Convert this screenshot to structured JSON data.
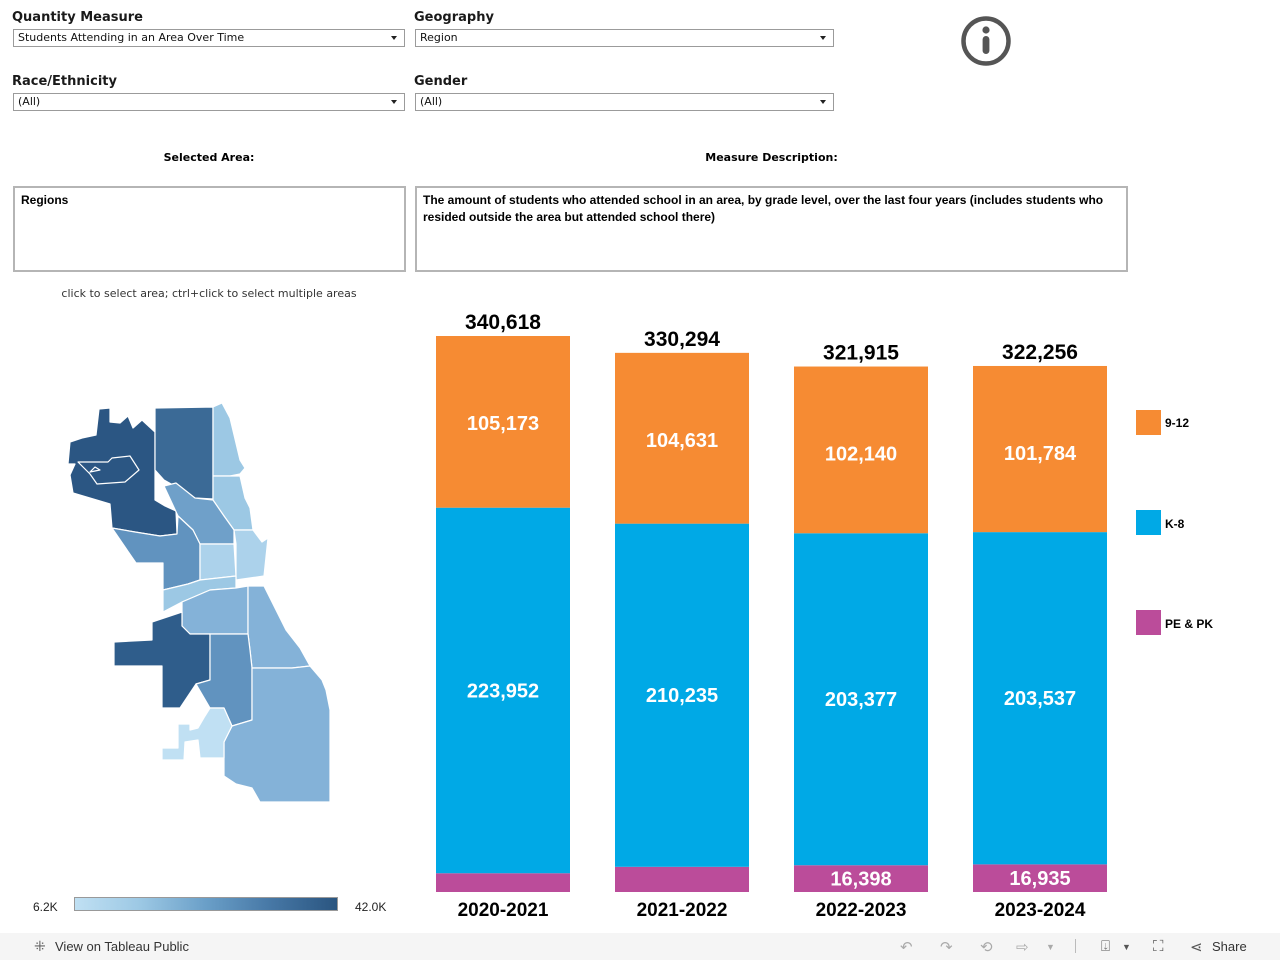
{
  "filters": {
    "quantity_measure": {
      "label": "Quantity Measure",
      "value": "Students Attending in an Area Over Time"
    },
    "geography": {
      "label": "Geography",
      "value": "Region"
    },
    "race_ethnicity": {
      "label": "Race/Ethnicity",
      "value": "(All)"
    },
    "gender": {
      "label": "Gender",
      "value": "(All)"
    }
  },
  "info_icon": "info-icon",
  "selected_area": {
    "header": "Selected Area:",
    "value": "Regions"
  },
  "measure_description": {
    "header": "Measure Description:",
    "value": "The amount of students who attended school in an area, by grade level, over the last four years (includes students who resided outside the area but attended school there)"
  },
  "map": {
    "hint": "click to select area; ctrl+click to select multiple areas",
    "color_scale": {
      "min_label": "6.2K",
      "max_label": "42.0K",
      "min_color": "#c0e0f3",
      "max_color": "#2a5580"
    }
  },
  "chart_data": {
    "type": "bar",
    "stacked": true,
    "title": "",
    "xlabel": "",
    "ylabel": "",
    "categories": [
      "2020-2021",
      "2021-2022",
      "2022-2023",
      "2023-2024"
    ],
    "series": [
      {
        "name": "PE & PK",
        "color": "#bb4c9a",
        "values": [
          11493,
          15428,
          16398,
          16935
        ],
        "show_labels": [
          false,
          false,
          true,
          true
        ],
        "labels": [
          "11,493",
          "15,428",
          "16,398",
          "16,935"
        ]
      },
      {
        "name": "K-8",
        "color": "#00a9e6",
        "values": [
          223952,
          210235,
          203377,
          203537
        ],
        "show_labels": [
          true,
          true,
          true,
          true
        ],
        "labels": [
          "223,952",
          "210,235",
          "203,377",
          "203,537"
        ]
      },
      {
        "name": "9-12",
        "color": "#f68b33",
        "values": [
          105173,
          104631,
          102140,
          101784
        ],
        "show_labels": [
          true,
          true,
          true,
          true
        ],
        "labels": [
          "105,173",
          "104,631",
          "102,140",
          "101,784"
        ]
      }
    ],
    "totals": [
      340618,
      330294,
      321915,
      322256
    ],
    "total_labels": [
      "340,618",
      "330,294",
      "321,915",
      "322,256"
    ],
    "ylim": [
      0,
      340618
    ],
    "grid": false,
    "legend": {
      "placement": "right",
      "order": [
        "9-12",
        "K-8",
        "PE & PK"
      ]
    }
  },
  "legend": [
    {
      "label": "9-12",
      "color": "#f68b33"
    },
    {
      "label": "K-8",
      "color": "#00a9e6"
    },
    {
      "label": "PE & PK",
      "color": "#bb4c9a"
    }
  ],
  "footer": {
    "view_label": "View on Tableau Public",
    "share_label": "Share"
  }
}
